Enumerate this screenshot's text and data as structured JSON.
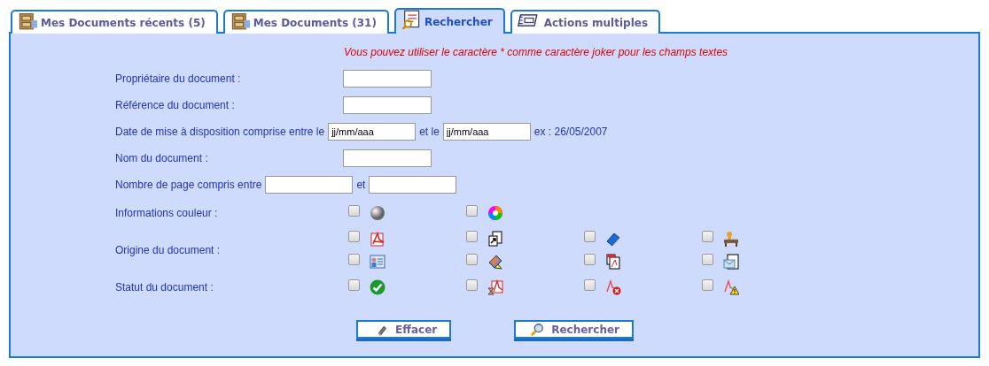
{
  "tabs": [
    {
      "label": "Mes Documents récents (5)",
      "selected": false
    },
    {
      "label": "Mes Documents (31)",
      "selected": false
    },
    {
      "label": "Rechercher",
      "selected": true
    },
    {
      "label": "Actions multiples",
      "selected": false
    }
  ],
  "note": "Vous pouvez utiliser le caractère * comme caractère joker pour les champs textes",
  "rows": [
    {
      "kind": "text",
      "label": "Propriétaire du document :"
    },
    {
      "kind": "text",
      "label": "Référence du document :"
    },
    {
      "kind": "range",
      "label": "Date de mise à disposition comprise entre le",
      "from": "jj/mm/aaa",
      "separator": "et le",
      "to": "jj/mm/aaa",
      "hint": "ex : 26/05/2007"
    },
    {
      "kind": "text",
      "label": "Nom du document :"
    },
    {
      "kind": "range",
      "label": "Nombre de page compris entre",
      "separator": "et"
    },
    {
      "kind": "checks",
      "label": "Informations couleur :",
      "options": [
        {
          "checked": false
        },
        {
          "checked": false
        }
      ]
    },
    {
      "kind": "checks",
      "label": "Origine du document :",
      "options": [
        {
          "checked": false
        },
        {
          "checked": false
        },
        {
          "checked": false
        },
        {
          "checked": false
        },
        {
          "checked": false
        },
        {
          "checked": false
        },
        {
          "checked": false
        },
        {
          "checked": false
        }
      ]
    },
    {
      "kind": "checks",
      "label": "Statut du document :",
      "options": [
        {
          "checked": false
        },
        {
          "checked": false
        },
        {
          "checked": false
        },
        {
          "checked": false
        }
      ]
    }
  ],
  "buttons": [
    "Effacer",
    "Rechercher"
  ]
}
